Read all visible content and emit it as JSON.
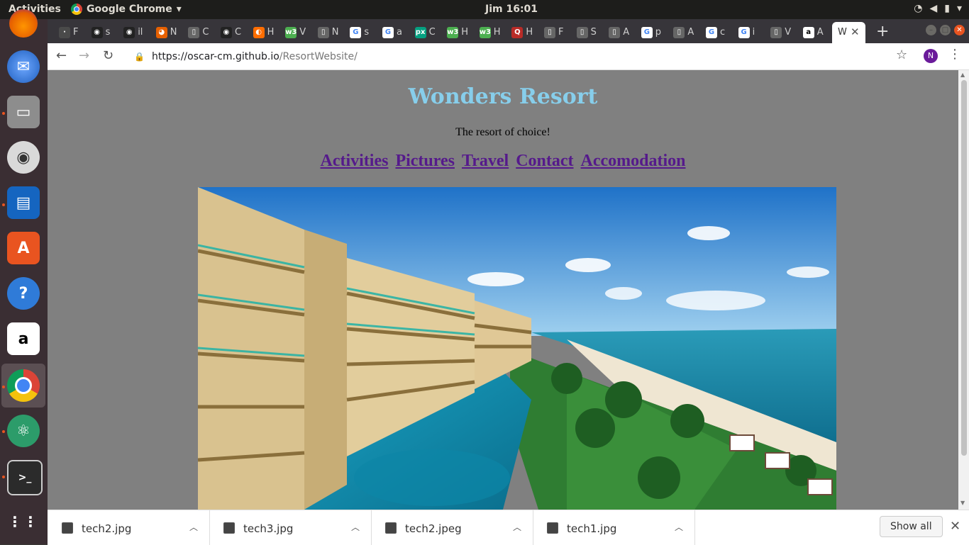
{
  "system": {
    "activities": "Activities",
    "app_name": "Google Chrome",
    "clock": "Jim 16:01"
  },
  "tabs": [
    {
      "title": "F",
      "icon": "generic-icon"
    },
    {
      "title": "s",
      "icon": "github-icon"
    },
    {
      "title": "il",
      "icon": "github-icon"
    },
    {
      "title": "N",
      "icon": "firefox-icon"
    },
    {
      "title": "C",
      "icon": "page-icon"
    },
    {
      "title": "C",
      "icon": "github-icon"
    },
    {
      "title": "H",
      "icon": "orange-icon"
    },
    {
      "title": "V",
      "icon": "w3-icon"
    },
    {
      "title": "N",
      "icon": "page-icon"
    },
    {
      "title": "s",
      "icon": "google-icon"
    },
    {
      "title": "a",
      "icon": "google-icon"
    },
    {
      "title": "C",
      "icon": "px-icon"
    },
    {
      "title": "H",
      "icon": "w3-icon"
    },
    {
      "title": "H",
      "icon": "w3-icon"
    },
    {
      "title": "H",
      "icon": "quora-icon"
    },
    {
      "title": "F",
      "icon": "page-icon"
    },
    {
      "title": "S",
      "icon": "page-icon"
    },
    {
      "title": "A",
      "icon": "page-icon"
    },
    {
      "title": "p",
      "icon": "google-icon"
    },
    {
      "title": "A",
      "icon": "page-icon"
    },
    {
      "title": "c",
      "icon": "google-icon"
    },
    {
      "title": "i",
      "icon": "google-icon"
    },
    {
      "title": "V",
      "icon": "page-icon"
    },
    {
      "title": "A",
      "icon": "amazon-icon"
    }
  ],
  "active_tab": {
    "title": "W",
    "close": "✕"
  },
  "new_tab": "+",
  "omnibox": {
    "host": "https://oscar-cm.github.io",
    "path": "/ResortWebsite/"
  },
  "profile_initial": "N",
  "page": {
    "title": "Wonders Resort",
    "tagline": "The resort of choice!",
    "nav": [
      "Activities",
      "Pictures",
      "Travel",
      "Contact",
      "Accomodation"
    ],
    "hero_alt": "Resort hotel beside the ocean"
  },
  "downloads": [
    {
      "name": "tech2.jpg"
    },
    {
      "name": "tech3.jpg"
    },
    {
      "name": "tech2.jpeg"
    },
    {
      "name": "tech1.jpg"
    }
  ],
  "shelf": {
    "show_all": "Show all"
  },
  "colors": {
    "title": "#87ceeb",
    "link": "#551a8b",
    "page_bg": "#808080"
  }
}
